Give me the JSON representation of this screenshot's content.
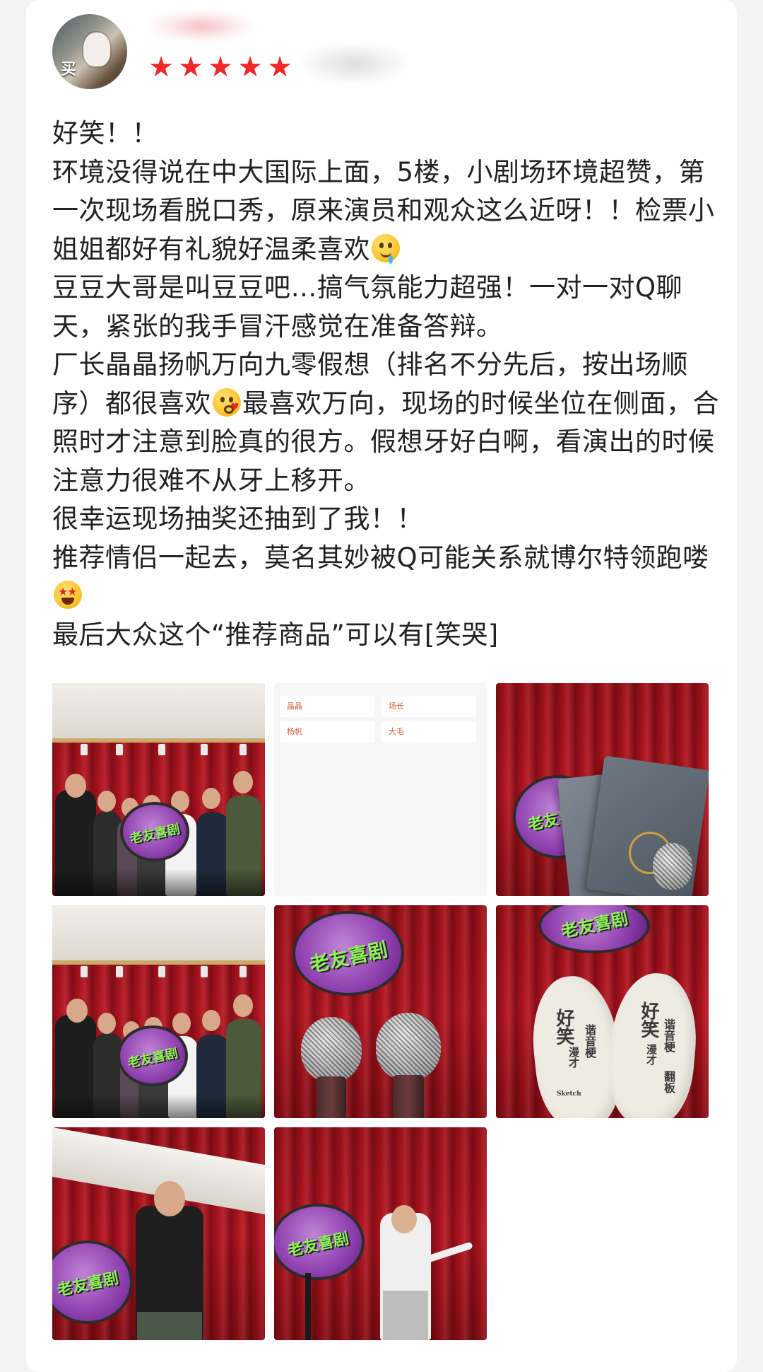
{
  "review": {
    "rating_stars": 5,
    "avatar_text": "买",
    "paragraphs": [
      "好笑！！",
      "环境没得说在中大国际上面，5楼，小剧场环境超赞，第一次现场看脱口秀，原来演员和观众这么近呀！！检票小姐姐都好有礼貌好温柔喜欢",
      "豆豆大哥是叫豆豆吧…搞气氛能力超强！一对一对Q聊天，紧张的我手冒汗感觉在准备答辩。",
      "厂长晶晶扬帆万向九零假想（排名不分先后，按出场顺序）都很喜欢",
      "最喜欢万向，现场的时候坐位在侧面，合照时才注意到脸真的很方。假想牙好白啊，看演出的时候注意力很难不从牙上移开。",
      "很幸运现场抽奖还抽到了我！！",
      "推荐情侣一起去，莫名其妙被Q可能关系就博尔特领跑喽",
      "最后大众这个“推荐商品”可以有[笑哭]"
    ],
    "photos": {
      "lineup_names": [
        "晶晶",
        "场长",
        "杨帆",
        "大毛"
      ],
      "sign_text": "老友喜剧",
      "fan_text_big": "好笑",
      "fan_text_small_1": "谐音梗",
      "fan_text_small_2": "漫才",
      "fan_text_small_3": "翻板",
      "fan_text_small_4": "Sketch"
    }
  },
  "colors": {
    "star": "#f2282a",
    "text": "#222222",
    "curtain": "#b5141f",
    "card_bg": "#ffffff",
    "page_bg": "#f3f3f3"
  }
}
